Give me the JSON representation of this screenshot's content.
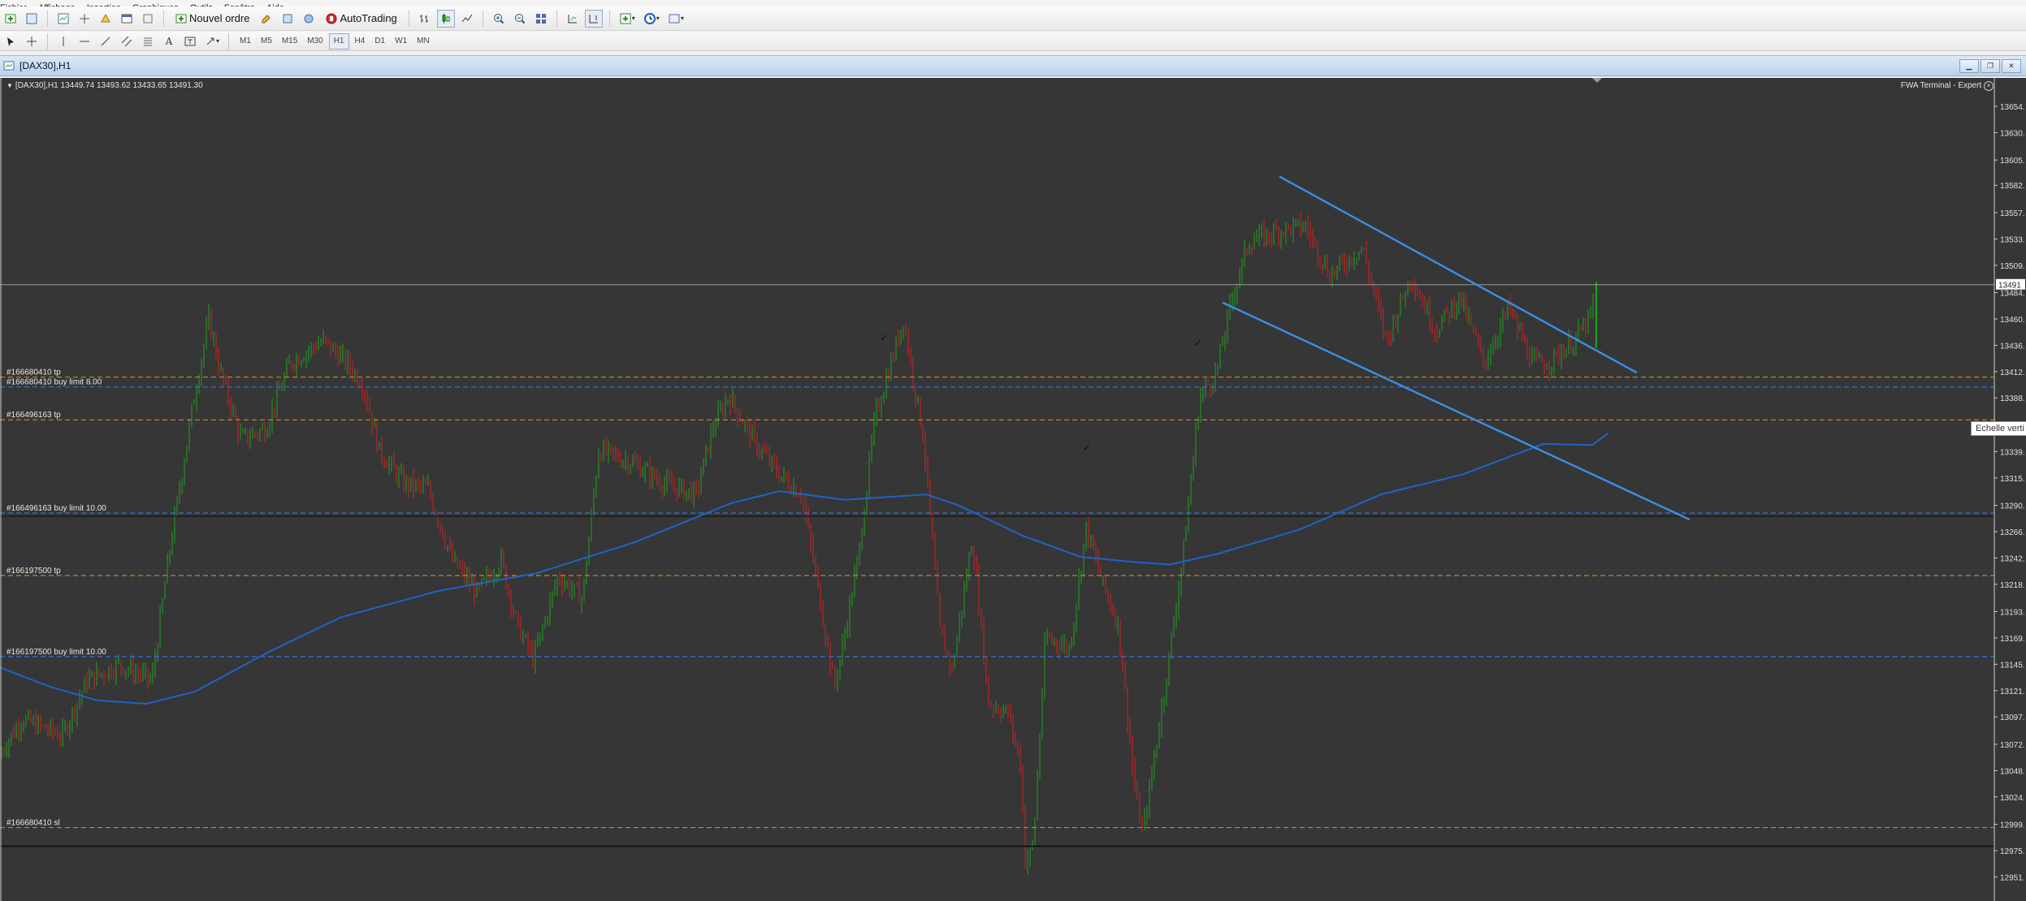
{
  "menu": [
    "Fichier",
    "Affichage",
    "Insertion",
    "Graphiques",
    "Outils",
    "Fenêtre",
    "Aide"
  ],
  "toolbar": {
    "new_order_label": "Nouvel ordre",
    "autotrading_label": "AutoTrading"
  },
  "periods": [
    {
      "label": "M1",
      "active": false
    },
    {
      "label": "M5",
      "active": false
    },
    {
      "label": "M15",
      "active": false
    },
    {
      "label": "M30",
      "active": false
    },
    {
      "label": "H1",
      "active": true
    },
    {
      "label": "H4",
      "active": false
    },
    {
      "label": "D1",
      "active": false
    },
    {
      "label": "W1",
      "active": false
    },
    {
      "label": "MN",
      "active": false
    }
  ],
  "window": {
    "title": "[DAX30],H1"
  },
  "chart_header": {
    "symbol_line": "[DAX30],H1  13449.74  13493.62  13433.65  13491.30",
    "expert_label": "FWA Terminal - Expert",
    "tooltip": "Echelle verti"
  },
  "colors": {
    "background": "#363636",
    "bull": "#1fa31f",
    "bear": "#d42020",
    "ma_line": "#1f63c8",
    "trend_line": "#3a8fe8",
    "tp_line": "#c9822a",
    "buy_limit_line": "#3a6fd8"
  },
  "chart_data": {
    "type": "candlestick",
    "symbol": "DAX30",
    "timeframe": "H1",
    "last": {
      "open": 13449.74,
      "high": 13493.62,
      "low": 13433.65,
      "close": 13491.3
    },
    "price_ticks": [
      "13654",
      "13630",
      "13605",
      "13582",
      "13557",
      "13533",
      "13509",
      "13484",
      "13460",
      "13436",
      "13412",
      "13388",
      "13363",
      "13339",
      "13315",
      "13290",
      "13266",
      "13242",
      "13218",
      "13193",
      "13169",
      "13145",
      "13121",
      "13097",
      "13072",
      "13048",
      "13024",
      "12999",
      "12975",
      "12951"
    ],
    "current_price_label": "13491",
    "ylim": [
      12932,
      13674
    ],
    "order_levels": [
      {
        "label": "#166680410 tp",
        "price": 13407,
        "kind": "tp"
      },
      {
        "label": "#166680410 buy limit 8.00",
        "price": 13398,
        "kind": "limit"
      },
      {
        "label": "#166496163 tp",
        "price": 13368,
        "kind": "tp"
      },
      {
        "label": "#166496163 buy limit 10.00",
        "price": 13283,
        "kind": "limit"
      },
      {
        "label": "#166197500 tp",
        "price": 13226,
        "kind": "tp"
      },
      {
        "label": "#166197500 buy limit 10.00",
        "price": 13152,
        "kind": "limit"
      },
      {
        "label": "#166680410 sl",
        "price": 12996,
        "kind": "tp"
      }
    ],
    "ma_path": [
      [
        0,
        13142
      ],
      [
        60,
        13125
      ],
      [
        120,
        13112
      ],
      [
        180,
        13109
      ],
      [
        240,
        13120
      ],
      [
        330,
        13156
      ],
      [
        420,
        13188
      ],
      [
        540,
        13212
      ],
      [
        660,
        13228
      ],
      [
        780,
        13256
      ],
      [
        900,
        13292
      ],
      [
        960,
        13303
      ],
      [
        1040,
        13295
      ],
      [
        1140,
        13300
      ],
      [
        1180,
        13290
      ],
      [
        1260,
        13262
      ],
      [
        1330,
        13243
      ],
      [
        1400,
        13238
      ],
      [
        1440,
        13236
      ],
      [
        1500,
        13246
      ],
      [
        1600,
        13268
      ],
      [
        1700,
        13300
      ],
      [
        1800,
        13318
      ],
      [
        1900,
        13346
      ],
      [
        1960,
        13345
      ],
      [
        1980,
        13356
      ]
    ],
    "trend_lines": [
      {
        "from": [
          1575,
          13590
        ],
        "to": [
          2015,
          13411
        ]
      },
      {
        "from": [
          1505,
          13475
        ],
        "to": [
          2080,
          13277
        ]
      }
    ],
    "anchors": [
      [
        0,
        13060
      ],
      [
        30,
        13095
      ],
      [
        80,
        13080
      ],
      [
        110,
        13130
      ],
      [
        150,
        13145
      ],
      [
        190,
        13130
      ],
      [
        210,
        13240
      ],
      [
        240,
        13380
      ],
      [
        260,
        13460
      ],
      [
        275,
        13410
      ],
      [
        300,
        13350
      ],
      [
        330,
        13360
      ],
      [
        360,
        13420
      ],
      [
        380,
        13430
      ],
      [
        400,
        13440
      ],
      [
        430,
        13420
      ],
      [
        450,
        13400
      ],
      [
        470,
        13340
      ],
      [
        500,
        13310
      ],
      [
        530,
        13305
      ],
      [
        560,
        13240
      ],
      [
        590,
        13210
      ],
      [
        620,
        13240
      ],
      [
        640,
        13180
      ],
      [
        660,
        13150
      ],
      [
        690,
        13225
      ],
      [
        720,
        13205
      ],
      [
        740,
        13340
      ],
      [
        780,
        13330
      ],
      [
        820,
        13310
      ],
      [
        860,
        13300
      ],
      [
        880,
        13360
      ],
      [
        900,
        13390
      ],
      [
        930,
        13350
      ],
      [
        960,
        13320
      ],
      [
        990,
        13300
      ],
      [
        1010,
        13215
      ],
      [
        1030,
        13125
      ],
      [
        1040,
        13160
      ],
      [
        1060,
        13245
      ],
      [
        1080,
        13370
      ],
      [
        1100,
        13420
      ],
      [
        1115,
        13460
      ],
      [
        1140,
        13350
      ],
      [
        1160,
        13175
      ],
      [
        1175,
        13140
      ],
      [
        1200,
        13260
      ],
      [
        1220,
        13110
      ],
      [
        1245,
        13100
      ],
      [
        1260,
        13050
      ],
      [
        1265,
        12965
      ],
      [
        1275,
        12980
      ],
      [
        1290,
        13170
      ],
      [
        1320,
        13160
      ],
      [
        1340,
        13270
      ],
      [
        1360,
        13220
      ],
      [
        1380,
        13180
      ],
      [
        1400,
        13030
      ],
      [
        1410,
        12990
      ],
      [
        1440,
        13140
      ],
      [
        1460,
        13250
      ],
      [
        1480,
        13390
      ],
      [
        1500,
        13410
      ],
      [
        1520,
        13480
      ],
      [
        1540,
        13530
      ],
      [
        1575,
        13540
      ],
      [
        1610,
        13545
      ],
      [
        1640,
        13500
      ],
      [
        1680,
        13525
      ],
      [
        1710,
        13440
      ],
      [
        1740,
        13500
      ],
      [
        1770,
        13450
      ],
      [
        1800,
        13480
      ],
      [
        1830,
        13420
      ],
      [
        1860,
        13470
      ],
      [
        1890,
        13420
      ],
      [
        1910,
        13420
      ],
      [
        1940,
        13440
      ],
      [
        1960,
        13460
      ],
      [
        1970,
        13490
      ]
    ]
  }
}
